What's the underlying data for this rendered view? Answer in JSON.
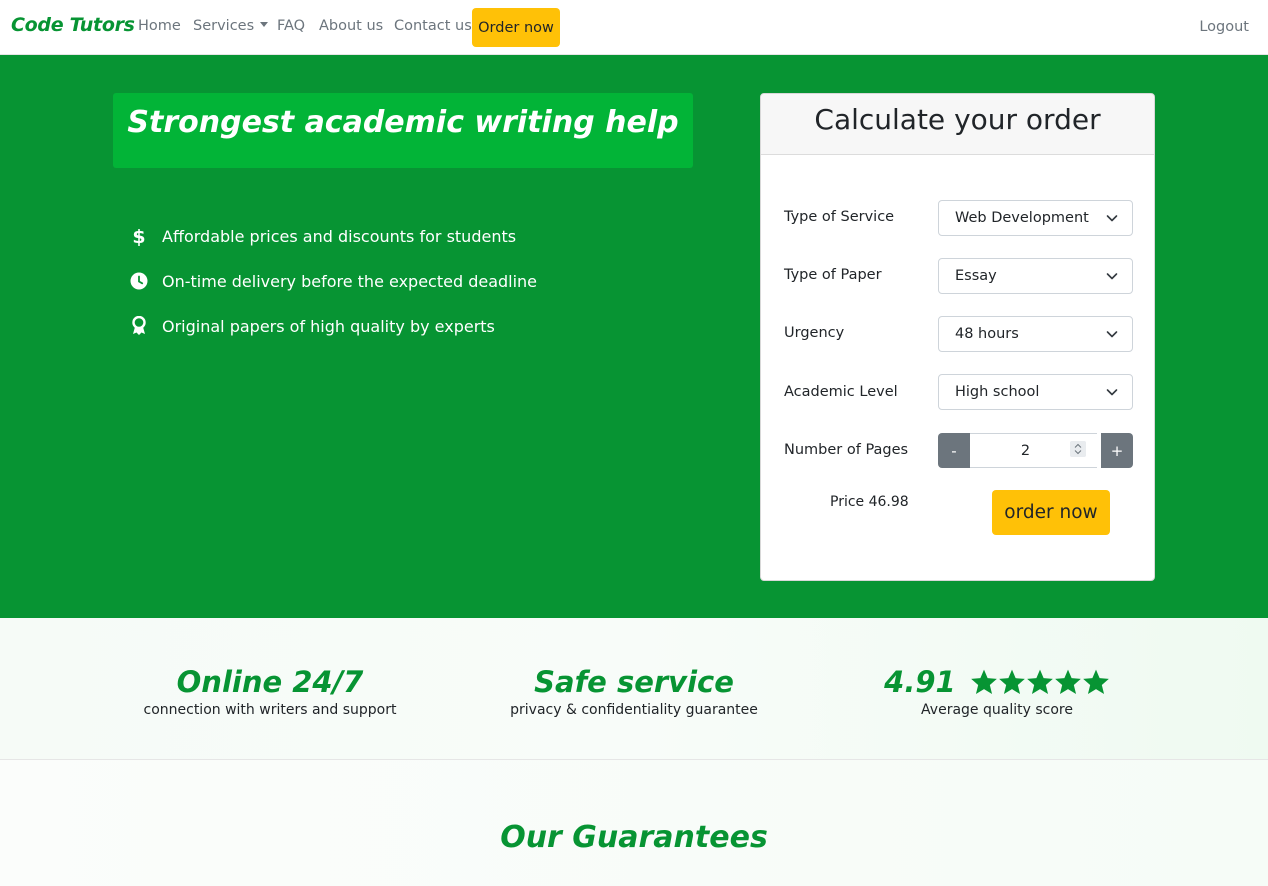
{
  "colors": {
    "brand_green": "#079433",
    "headline_green": "#02b437",
    "accent_yellow": "#ffc107",
    "stepper_gray": "#6c757d"
  },
  "navbar": {
    "brand": "Code Tutors",
    "links": {
      "home": "Home",
      "services": "Services",
      "faq": "FAQ",
      "about": "About us",
      "contact": "Contact us"
    },
    "order_now": "Order now",
    "logout": "Logout"
  },
  "hero": {
    "headline": "Strongest academic writing help",
    "features": [
      {
        "icon": "dollar-icon",
        "text": "Affordable prices and discounts for students"
      },
      {
        "icon": "clock-icon",
        "text": "On-time delivery before the expected deadline"
      },
      {
        "icon": "award-icon",
        "text": "Original papers of high quality by experts"
      }
    ]
  },
  "calculator": {
    "title": "Calculate your order",
    "fields": {
      "service": {
        "label": "Type of Service",
        "value": "Web Development"
      },
      "paper": {
        "label": "Type of Paper",
        "value": "Essay"
      },
      "urgency": {
        "label": "Urgency",
        "value": "48 hours"
      },
      "level": {
        "label": "Academic Level",
        "value": "High school"
      },
      "pages": {
        "label": "Number of Pages",
        "value": "2",
        "minus": "-",
        "plus": "+"
      }
    },
    "price": "Price 46.98",
    "order_button": "order now"
  },
  "stats": {
    "online": {
      "title": "Online 24/7",
      "subtitle": "connection with writers and support"
    },
    "safe": {
      "title": "Safe service",
      "subtitle": "privacy & confidentiality guarantee"
    },
    "rating": {
      "score": "4.91",
      "stars": 5,
      "subtitle": "Average quality score"
    }
  },
  "guarantees": {
    "title": "Our Guarantees"
  }
}
